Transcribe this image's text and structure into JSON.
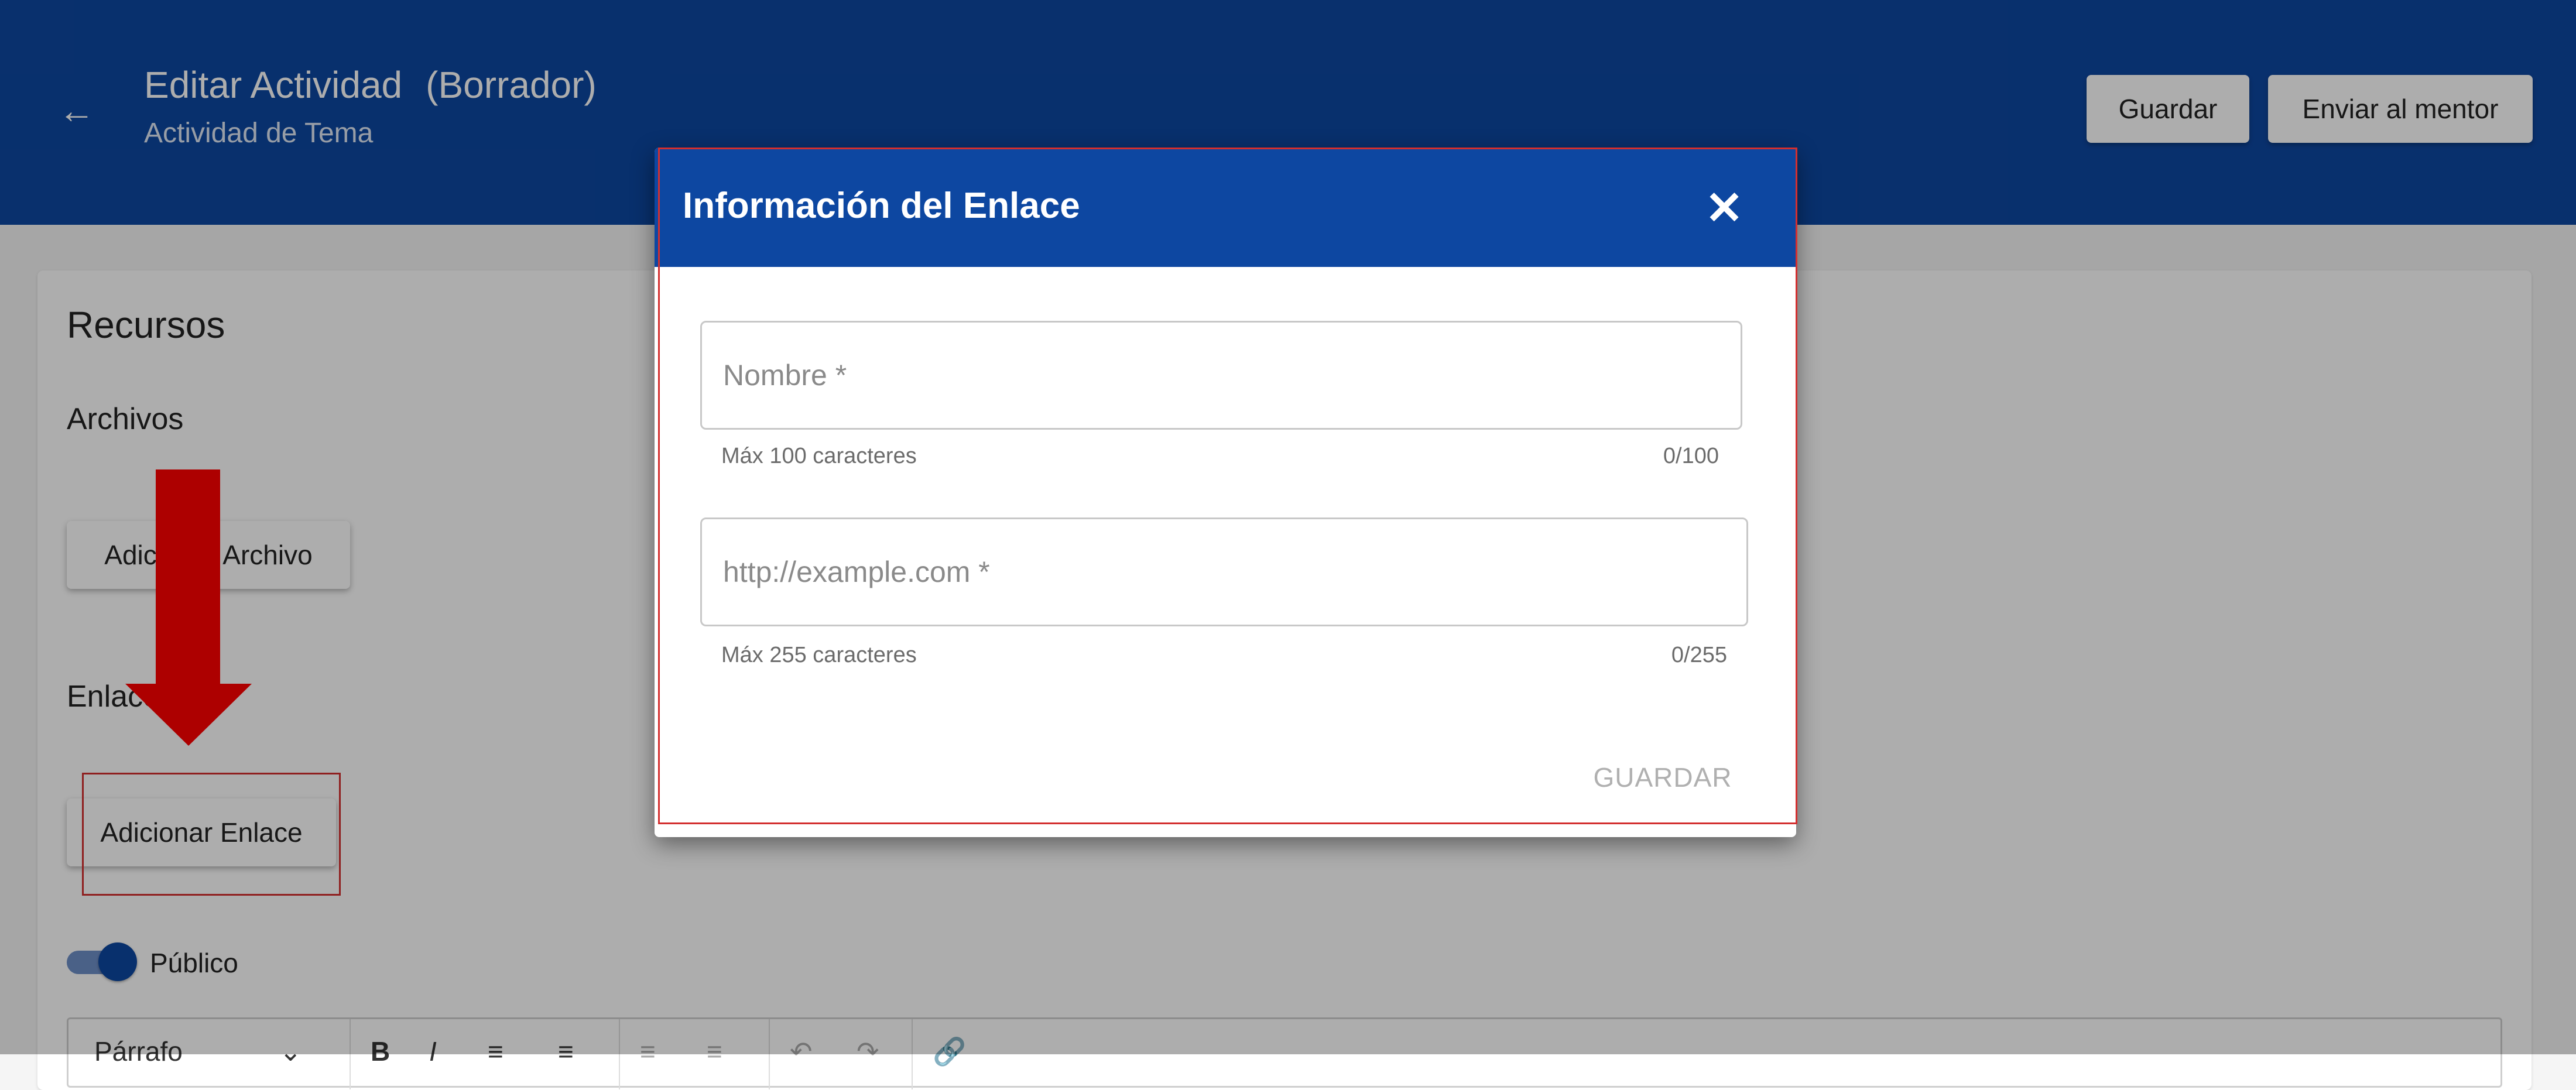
{
  "header": {
    "back_icon": "arrow-left-icon",
    "title": "Editar Actividad",
    "status": "(Borrador)",
    "subtitle": "Actividad de Tema",
    "save_label": "Guardar",
    "send_label": "Enviar al mentor",
    "color": "#0d47a1"
  },
  "page": {
    "card_title": "Recursos",
    "files_label": "Archivos",
    "add_file_label": "Adicionar Archivo",
    "links_label": "Enlaces",
    "add_link_label": "Adicionar Enlace",
    "public_label": "Público",
    "public_toggle_on": true,
    "editor_toolbar": {
      "block_format": "Párrafo",
      "bold": "B",
      "italic": "I"
    }
  },
  "dialog": {
    "title": "Información del Enlace",
    "close_icon": "close-icon",
    "name_field": {
      "placeholder": "Nombre *",
      "value": "",
      "hint": "Máx 100 caracteres",
      "counter": "0/100"
    },
    "url_field": {
      "placeholder": "http://example.com *",
      "value": "",
      "hint": "Máx 255 caracteres",
      "counter": "0/255"
    },
    "save_label": "GUARDAR",
    "header_color": "#0d47a1"
  },
  "annotation": {
    "arrow_color": "#ff0000",
    "highlight_color": "#d32f2f"
  }
}
